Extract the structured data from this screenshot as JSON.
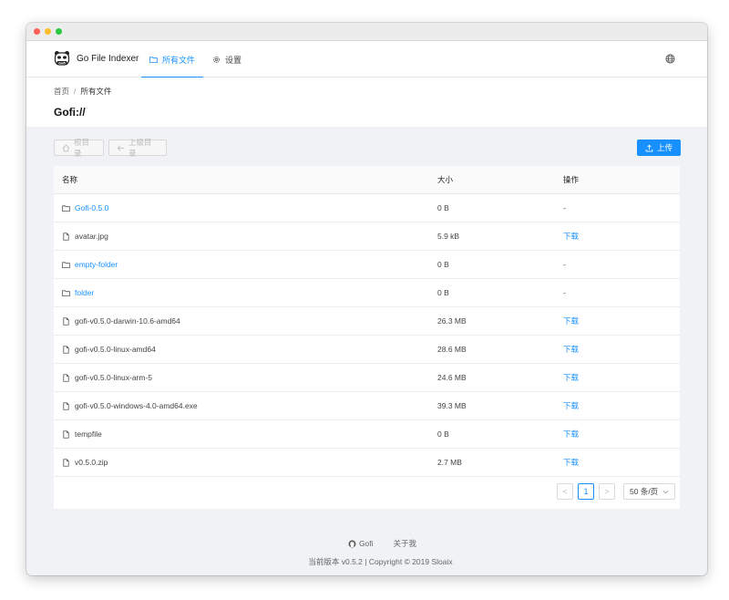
{
  "app": {
    "brand": "Go File Indexer",
    "logo_text": "Gofi"
  },
  "nav": {
    "files_label": "所有文件",
    "settings_label": "设置"
  },
  "breadcrumb": {
    "home": "首页",
    "sep": "/",
    "current": "所有文件"
  },
  "page_title": "Gofi://",
  "toolbar": {
    "root_label": "根目录",
    "parent_label": "上级目录",
    "upload_label": "上传"
  },
  "table": {
    "columns": {
      "name": "名称",
      "size": "大小",
      "op": "操作"
    },
    "rows": [
      {
        "name": "Gofi-0.5.0",
        "type": "folder",
        "size": "0 B",
        "op": "-"
      },
      {
        "name": "avatar.jpg",
        "type": "file",
        "size": "5.9 kB",
        "op": "下载"
      },
      {
        "name": "empty-folder",
        "type": "folder",
        "size": "0 B",
        "op": "-"
      },
      {
        "name": "folder",
        "type": "folder",
        "size": "0 B",
        "op": "-"
      },
      {
        "name": "gofi-v0.5.0-darwin-10.6-amd64",
        "type": "file",
        "size": "26.3 MB",
        "op": "下载"
      },
      {
        "name": "gofi-v0.5.0-linux-amd64",
        "type": "file",
        "size": "28.6 MB",
        "op": "下载"
      },
      {
        "name": "gofi-v0.5.0-linux-arm-5",
        "type": "file",
        "size": "24.6 MB",
        "op": "下载"
      },
      {
        "name": "gofi-v0.5.0-windows-4.0-amd64.exe",
        "type": "file",
        "size": "39.3 MB",
        "op": "下载"
      },
      {
        "name": "tempfile",
        "type": "file",
        "size": "0 B",
        "op": "下载"
      },
      {
        "name": "v0.5.0.zip",
        "type": "file",
        "size": "2.7 MB",
        "op": "下载"
      }
    ]
  },
  "pagination": {
    "prev": "<",
    "current_page": "1",
    "next": ">",
    "page_size": "50 条/页"
  },
  "footer": {
    "github_label": "Gofi",
    "about_label": "关于我",
    "copyright": "当前版本 v0.5.2 | Copyright © 2019 Sloaix"
  },
  "colors": {
    "accent": "#1890ff",
    "background": "#f0f2f5"
  }
}
